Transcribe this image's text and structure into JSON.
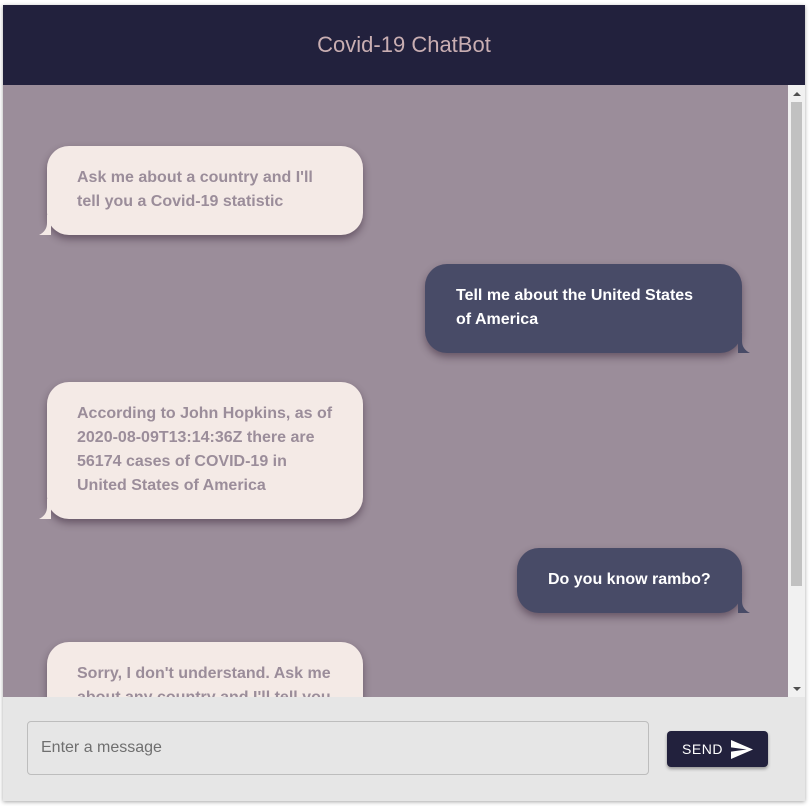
{
  "header": {
    "title": "Covid-19 ChatBot"
  },
  "messages": [
    {
      "sender": "bot",
      "text": "Ask me about a country and I'll tell you a Covid-19 statistic"
    },
    {
      "sender": "user",
      "text": "Tell me about the United States of America"
    },
    {
      "sender": "bot",
      "text": "According to John Hopkins, as of 2020-08-09T13:14:36Z there are 56174 cases of COVID-19 in United States of America"
    },
    {
      "sender": "user",
      "text": "Do you know rambo?"
    },
    {
      "sender": "bot",
      "text": "Sorry, I don't understand. Ask me about any country and I'll tell you"
    }
  ],
  "composer": {
    "placeholder": "Enter a message",
    "send_label": "SEND"
  },
  "colors": {
    "header_bg": "#22213d",
    "title": "#c9aeb2",
    "chat_bg": "#9b8d9a",
    "bot_bubble": "#f4eae6",
    "user_bubble": "#484b67"
  },
  "icons": {
    "send": "send-icon"
  }
}
